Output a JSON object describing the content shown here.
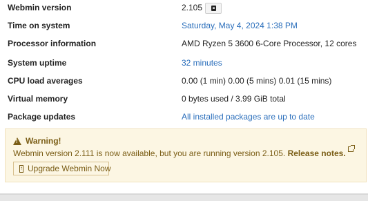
{
  "system_info": {
    "rows": [
      {
        "label": "Webmin version",
        "value": "2.105"
      },
      {
        "label": "Time on system",
        "value": "Saturday, May 4, 2024 1:38 PM"
      },
      {
        "label": "Processor information",
        "value": "AMD Ryzen 5 3600 6-Core Processor, 12 cores"
      },
      {
        "label": "System uptime",
        "value": "32 minutes"
      },
      {
        "label": "CPU load averages",
        "value": "0.00 (1 min) 0.00 (5 mins) 0.01 (15 mins)"
      },
      {
        "label": "Virtual memory",
        "value": "0 bytes used / 3.99 GiB total"
      },
      {
        "label": "Package updates",
        "value": "All installed packages are up to date"
      }
    ]
  },
  "warning": {
    "title": "Warning!",
    "message": "Webmin version 2.111 is now available, but you are running version 2.105.",
    "release_notes_label": "Release notes.",
    "upgrade_button_label": "Upgrade Webmin Now"
  },
  "colors": {
    "link": "#2a6ebb",
    "warning_text": "#7a5d15",
    "warning_bg": "#fcf6e3"
  }
}
